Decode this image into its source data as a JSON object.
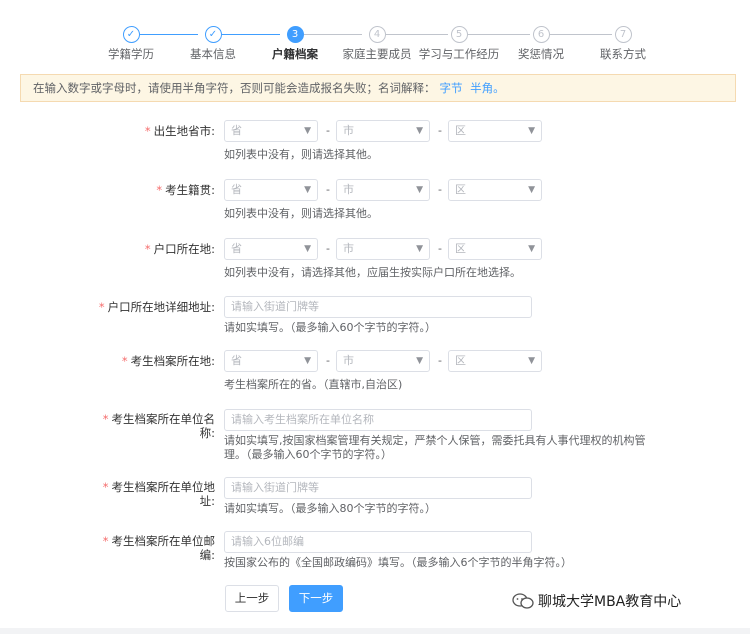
{
  "steps": [
    {
      "num": "✓",
      "label": "学籍学历"
    },
    {
      "num": "✓",
      "label": "基本信息"
    },
    {
      "num": "3",
      "label": "户籍档案"
    },
    {
      "num": "4",
      "label": "家庭主要成员"
    },
    {
      "num": "5",
      "label": "学习与工作经历"
    },
    {
      "num": "6",
      "label": "奖惩情况"
    },
    {
      "num": "7",
      "label": "联系方式"
    }
  ],
  "notice": {
    "text": "在输入数字或字母时，请使用半角字符，否则可能会造成报名失败；名词解释：",
    "link1": "字节",
    "link2": "半角。"
  },
  "form": {
    "birthplace": {
      "label": "出生地省市:",
      "province": "省",
      "city": "市",
      "district": "区",
      "hint": "如列表中没有，则请选择其他。"
    },
    "native": {
      "label": "考生籍贯:",
      "province": "省",
      "city": "市",
      "district": "区",
      "hint": "如列表中没有，则请选择其他。"
    },
    "hukou": {
      "label": "户口所在地:",
      "province": "省",
      "city": "市",
      "district": "区",
      "hint": "如列表中没有，请选择其他，应届生按实际户口所在地选择。"
    },
    "hukou_addr": {
      "label": "户口所在地详细地址:",
      "placeholder": "请输入街道门牌等",
      "hint": "请如实填写。（最多输入60个字节的字符。）"
    },
    "archive_loc": {
      "label": "考生档案所在地:",
      "province": "省",
      "city": "市",
      "district": "区",
      "hint": "考生档案所在的省。（直辖市,自治区)"
    },
    "archive_unit": {
      "label1": "考生档案所在单位名",
      "label2": "称:",
      "placeholder": "请输入考生档案所在单位名称",
      "hint1": "请如实填写,按国家档案管理有关规定，严禁个人保管，需委托具有人事代理权的机构管",
      "hint2": "理。（最多输入60个字节的字符。）"
    },
    "archive_addr": {
      "label1": "考生档案所在单位地",
      "label2": "址:",
      "placeholder": "请输入街道门牌等",
      "hint": "请如实填写。（最多输入80个字节的字符。）"
    },
    "archive_zip": {
      "label1": "考生档案所在单位邮",
      "label2": "编:",
      "placeholder": "请输入6位邮编",
      "hint": "按国家公布的《全国邮政编码》填写。（最多输入6个字节的半角字符。）"
    }
  },
  "buttons": {
    "prev": "上一步",
    "next": "下一步"
  },
  "watermark": "聊城大学MBA教育中心",
  "colors": {
    "primary": "#409eff",
    "required": "#f56c6c",
    "notice_bg": "#fdf6e4"
  }
}
